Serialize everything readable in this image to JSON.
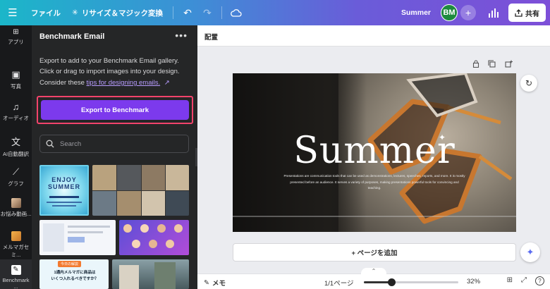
{
  "topbar": {
    "menu_icon": "hamburger-icon",
    "file_label": "ファイル",
    "resize_label": "リサイズ＆マジック変換",
    "project_title": "Summer",
    "avatar_initials": "BM",
    "share_label": "共有"
  },
  "rail": {
    "items": [
      {
        "label": "アプリ",
        "icon": "apps-icon"
      },
      {
        "label": "写真",
        "icon": "photo-icon"
      },
      {
        "label": "オーディオ",
        "icon": "music-icon"
      },
      {
        "label": "AI自動翻訳",
        "icon": "translate-icon"
      },
      {
        "label": "グラフ",
        "icon": "graph-icon"
      },
      {
        "label": "お悩み動画...",
        "icon": "app-thumb-icon"
      },
      {
        "label": "メルマガセミ...",
        "icon": "app-thumb-icon"
      },
      {
        "label": "Benchmark ...",
        "icon": "benchmark-icon"
      }
    ]
  },
  "panel": {
    "title": "Benchmark Email",
    "description": "Export to add to your Benchmark Email gallery. Click or drag to import images into your design.",
    "tip_prefix": "Consider these ",
    "tip_link": "tips for designing emails.",
    "export_label": "Export to Benchmark",
    "search_placeholder": "Search",
    "thumb_enjoy_line1": "ENJOY",
    "thumb_enjoy_line2": "SUMMER",
    "thumb_jp_badge": "今日の解説",
    "thumb_jp_line1": "1通内メルマガに商品は",
    "thumb_jp_line2": "いくつ入れるべきですか？"
  },
  "canvas": {
    "arrange_label": "配置",
    "slide_title": "Summer",
    "slide_subtitle": "Presentations are communication tools that can be used as demonstrations, lectures, speeches, reports, and more. It is mostly presented before an audience. It serves a variety of purposes, making presentations powerful tools for convincing and teaching.",
    "add_page_label": "+ ページを追加"
  },
  "bottombar": {
    "notes_label": "メモ",
    "page_indicator": "1/1ページ",
    "zoom_percent": "32%",
    "zoom_fraction": 0.29
  },
  "colors": {
    "accent": "#7c3aed",
    "highlight": "#f2436b",
    "avatar": "#1e8a3e"
  }
}
